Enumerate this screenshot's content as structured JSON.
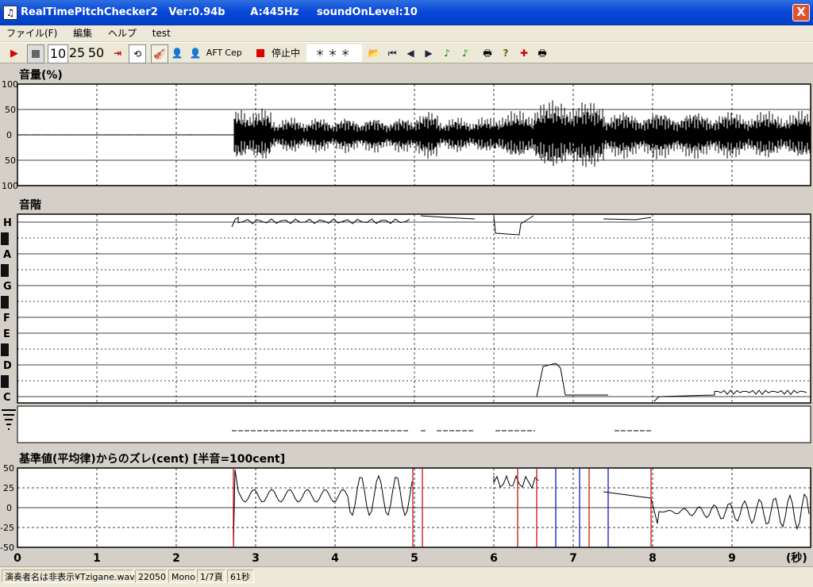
{
  "window": {
    "title": "RealTimePitchChecker2   Ver:0.94b       A:445Hz     soundOnLevel:10",
    "close_label": "X"
  },
  "menu": [
    "ファイル(F)",
    "編集",
    "ヘルプ",
    "test"
  ],
  "toolbar": {
    "play_icon": "play-icon",
    "stop_icon": "stop-icon",
    "zoom_options": [
      "10",
      "25",
      "50"
    ],
    "aft_label": "AFT",
    "cep_label": "Cep",
    "status_label": "停止中",
    "note_display": "＊＊＊",
    "record_color": "#e00000"
  },
  "panels": {
    "volume": {
      "title": "音量(%)",
      "y_ticks": [
        "100",
        "50",
        "0",
        "50",
        "100"
      ]
    },
    "scale": {
      "title": "音階",
      "notes": [
        "H",
        "A",
        "G",
        "F",
        "E",
        "D",
        "C"
      ]
    },
    "cent": {
      "title": "基準値(平均律)からのズレ(cent) [半音=100cent]",
      "y_ticks": [
        "50",
        "25",
        "0",
        "-25",
        "-50"
      ]
    }
  },
  "x_axis": {
    "ticks": [
      "0",
      "1",
      "2",
      "3",
      "4",
      "5",
      "6",
      "7",
      "8",
      "9"
    ],
    "unit": "(秒)"
  },
  "status": {
    "file": "演奏者名は非表示¥Tzigane.wav",
    "rate": "22050",
    "channels": "Mono",
    "page": "1/7頁",
    "duration": "61秒"
  }
}
